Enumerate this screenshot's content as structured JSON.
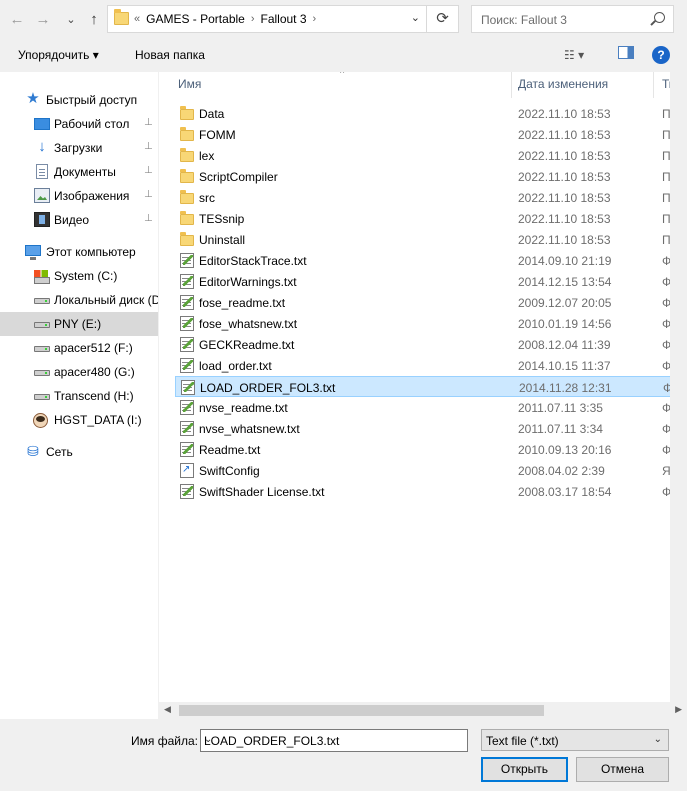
{
  "nav_buttons": {
    "back": "←",
    "forward": "→",
    "recent": "⌄",
    "up": "↑"
  },
  "address": {
    "overflow": "«",
    "crumbs": [
      "GAMES - Portable",
      "Fallout 3"
    ],
    "separator": "›",
    "dropdown": "⌄",
    "refresh": "⟳"
  },
  "search": {
    "placeholder": "Поиск: Fallout 3"
  },
  "toolbar": {
    "organize": "Упорядочить ▾",
    "new_folder": "Новая папка",
    "view": "☷ ▾",
    "preview": "▯",
    "help": "?"
  },
  "sidebar": {
    "items": [
      {
        "label": "Быстрый доступ",
        "icon": "star-icon"
      },
      {
        "label": "Рабочий стол",
        "icon": "desktop-icon",
        "pinned": true
      },
      {
        "label": "Загрузки",
        "icon": "download-icon",
        "pinned": true
      },
      {
        "label": "Документы",
        "icon": "documents-icon",
        "pinned": true
      },
      {
        "label": "Изображения",
        "icon": "pictures-icon",
        "pinned": true
      },
      {
        "label": "Видео",
        "icon": "video-icon",
        "pinned": true
      },
      {
        "label": "Этот компьютер",
        "icon": "computer-icon"
      },
      {
        "label": "System (C:)",
        "icon": "system-drive-icon"
      },
      {
        "label": "Локальный диск (D",
        "icon": "drive-icon"
      },
      {
        "label": "PNY (E:)",
        "icon": "drive-icon",
        "selected": true
      },
      {
        "label": "apacer512 (F:)",
        "icon": "drive-icon"
      },
      {
        "label": "apacer480 (G:)",
        "icon": "drive-icon"
      },
      {
        "label": "Transcend (H:)",
        "icon": "drive-icon"
      },
      {
        "label": "HGST_DATA (I:)",
        "icon": "avatar-drive-icon"
      },
      {
        "label": "Сеть",
        "icon": "network-icon"
      }
    ],
    "pin_glyph": "📌"
  },
  "columns": {
    "name": "Имя",
    "date": "Дата изменения",
    "type": "Тип",
    "sort_indicator": "^"
  },
  "files": [
    {
      "name": "Data",
      "date": "2022.11.10 18:53",
      "type": "Папк",
      "kind": "folder"
    },
    {
      "name": "FOMM",
      "date": "2022.11.10 18:53",
      "type": "Папк",
      "kind": "folder"
    },
    {
      "name": "lex",
      "date": "2022.11.10 18:53",
      "type": "Папк",
      "kind": "folder"
    },
    {
      "name": "ScriptCompiler",
      "date": "2022.11.10 18:53",
      "type": "Папк",
      "kind": "folder"
    },
    {
      "name": "src",
      "date": "2022.11.10 18:53",
      "type": "Папк",
      "kind": "folder"
    },
    {
      "name": "TESsnip",
      "date": "2022.11.10 18:53",
      "type": "Папк",
      "kind": "folder"
    },
    {
      "name": "Uninstall",
      "date": "2022.11.10 18:53",
      "type": "Папк",
      "kind": "folder"
    },
    {
      "name": "EditorStackTrace.txt",
      "date": "2014.09.10 21:19",
      "type": "Файл",
      "kind": "text"
    },
    {
      "name": "EditorWarnings.txt",
      "date": "2014.12.15 13:54",
      "type": "Файл",
      "kind": "text"
    },
    {
      "name": "fose_readme.txt",
      "date": "2009.12.07 20:05",
      "type": "Файл",
      "kind": "text"
    },
    {
      "name": "fose_whatsnew.txt",
      "date": "2010.01.19 14:56",
      "type": "Файл",
      "kind": "text"
    },
    {
      "name": "GECKReadme.txt",
      "date": "2008.12.04 11:39",
      "type": "Файл",
      "kind": "text"
    },
    {
      "name": "load_order.txt",
      "date": "2014.10.15 11:37",
      "type": "Файл",
      "kind": "text"
    },
    {
      "name": "LOAD_ORDER_FOL3.txt",
      "date": "2014.11.28 12:31",
      "type": "Файл",
      "kind": "text",
      "selected": true
    },
    {
      "name": "nvse_readme.txt",
      "date": "2011.07.11 3:35",
      "type": "Файл",
      "kind": "text"
    },
    {
      "name": "nvse_whatsnew.txt",
      "date": "2011.07.11 3:34",
      "type": "Файл",
      "kind": "text"
    },
    {
      "name": "Readme.txt",
      "date": "2010.09.13 20:16",
      "type": "Файл",
      "kind": "text"
    },
    {
      "name": "SwiftConfig",
      "date": "2008.04.02 2:39",
      "type": "Ярлы",
      "kind": "shortcut"
    },
    {
      "name": "SwiftShader License.txt",
      "date": "2008.03.17 18:54",
      "type": "Файл",
      "kind": "text"
    }
  ],
  "footer": {
    "filename_label": "Имя файла:",
    "filename_value": "LOAD_ORDER_FOL3.txt",
    "filetype_value": "Text file (*.txt)",
    "open_button": "Открыть",
    "cancel_button": "Отмена",
    "chevron": "⌄"
  }
}
